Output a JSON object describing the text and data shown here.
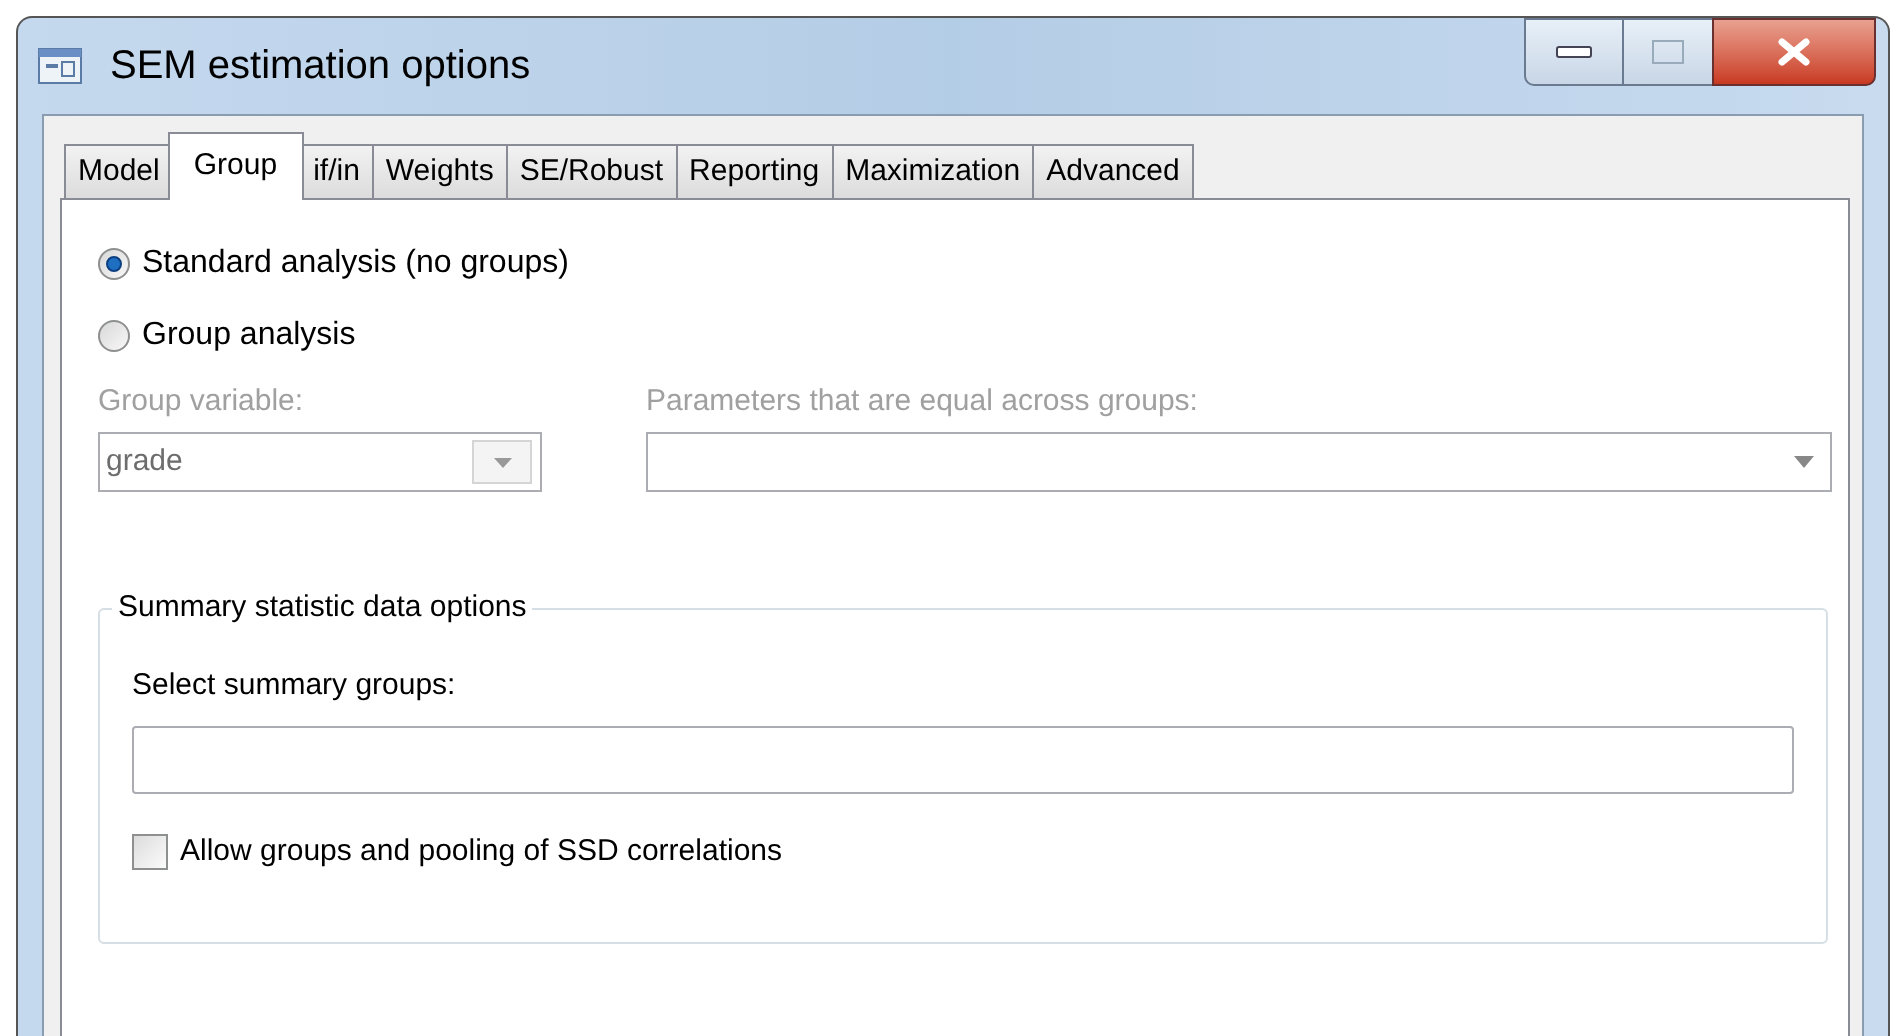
{
  "window": {
    "title": "SEM estimation options"
  },
  "tabs": [
    {
      "label": "Model",
      "selected": false
    },
    {
      "label": "Group",
      "selected": true
    },
    {
      "label": "if/in",
      "selected": false
    },
    {
      "label": "Weights",
      "selected": false
    },
    {
      "label": "SE/Robust",
      "selected": false
    },
    {
      "label": "Reporting",
      "selected": false
    },
    {
      "label": "Maximization",
      "selected": false
    },
    {
      "label": "Advanced",
      "selected": false
    }
  ],
  "analysis": [
    {
      "label": "Standard analysis (no groups)",
      "selected": true
    },
    {
      "label": "Group analysis",
      "selected": false
    }
  ],
  "group_variable": {
    "label": "Group variable:",
    "value": "grade",
    "disabled": true
  },
  "equal_parameters": {
    "label": "Parameters that are equal across groups:",
    "disabled": true
  },
  "summary_options": {
    "title": "Summary statistic data options",
    "groups_label": "Select summary groups:",
    "pooling": {
      "label": "Allow groups and pooling of SSD correlations",
      "checked": false
    }
  }
}
